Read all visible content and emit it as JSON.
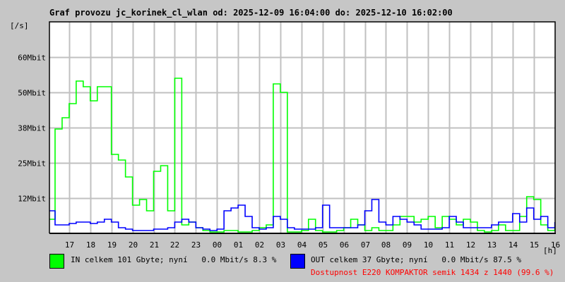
{
  "chart_data": {
    "type": "line",
    "title": "Graf provozu jc_korinek_cl_wlan od: 2025-12-09 16:04:00 do: 2025-12-10 16:02:00",
    "ylabel": "[/s]",
    "xlabel": "[h]",
    "ylim": [
      0,
      75
    ],
    "y_unit": "Mbit",
    "grid": true,
    "y_ticks": [
      {
        "value": 12.5,
        "label": "12Mbit"
      },
      {
        "value": 25,
        "label": "25Mbit"
      },
      {
        "value": 37.5,
        "label": "38Mbit"
      },
      {
        "value": 50,
        "label": "50Mbit"
      },
      {
        "value": 62.5,
        "label": "60Mbit"
      }
    ],
    "x_start": "16:04",
    "x_end": "16:02",
    "x_ticks": [
      "17",
      "18",
      "19",
      "20",
      "21",
      "22",
      "23",
      "00",
      "01",
      "02",
      "03",
      "04",
      "05",
      "06",
      "07",
      "08",
      "09",
      "10",
      "11",
      "12",
      "13",
      "14",
      "15",
      "16"
    ],
    "x": [
      "16:04",
      "16:20",
      "16:40",
      "17:00",
      "17:20",
      "17:40",
      "18:00",
      "18:20",
      "18:40",
      "19:00",
      "19:20",
      "19:40",
      "20:00",
      "20:20",
      "20:40",
      "21:00",
      "21:20",
      "21:40",
      "22:00",
      "22:20",
      "22:40",
      "23:00",
      "23:20",
      "23:40",
      "00:00",
      "00:20",
      "00:40",
      "01:00",
      "01:20",
      "01:40",
      "02:00",
      "02:20",
      "02:40",
      "03:00",
      "03:20",
      "03:40",
      "04:00",
      "04:20",
      "04:40",
      "05:00",
      "05:20",
      "05:40",
      "06:00",
      "06:20",
      "06:40",
      "07:00",
      "07:20",
      "07:40",
      "08:00",
      "08:20",
      "08:40",
      "09:00",
      "09:20",
      "09:40",
      "10:00",
      "10:20",
      "10:40",
      "11:00",
      "11:20",
      "11:40",
      "12:00",
      "12:20",
      "12:40",
      "13:00",
      "13:20",
      "13:40",
      "14:00",
      "14:20",
      "14:40",
      "15:00",
      "15:20",
      "15:40",
      "16:00"
    ],
    "series": [
      {
        "name": "IN",
        "color": "#00ff00",
        "values": [
          5,
          37,
          41,
          46,
          54,
          52,
          47,
          52,
          52,
          28,
          26,
          20,
          10,
          12,
          8,
          22,
          24,
          8,
          55,
          3,
          4,
          2,
          1,
          0.5,
          0.5,
          1,
          1,
          0.5,
          0.5,
          1,
          2,
          3,
          53,
          50,
          0.5,
          0.5,
          1,
          5,
          1,
          0.5,
          0.5,
          1,
          2,
          5,
          3,
          1,
          2,
          1,
          1,
          3,
          6,
          6,
          4,
          5,
          6,
          2,
          6,
          5,
          3,
          5,
          4,
          1,
          0.5,
          1,
          3,
          1,
          1,
          6,
          13,
          12,
          3,
          1,
          2
        ]
      },
      {
        "name": "OUT",
        "color": "#0000ff",
        "values": [
          8,
          3,
          3,
          3.5,
          4,
          4,
          3.5,
          4,
          5,
          4,
          2,
          1.5,
          1,
          1,
          1,
          1.5,
          1.5,
          2,
          4,
          5,
          4,
          2,
          1.5,
          1,
          1.5,
          8,
          9,
          10,
          6,
          2,
          1.5,
          2,
          6,
          5,
          2,
          1.5,
          1.5,
          1.5,
          2,
          10,
          2,
          2,
          2,
          2,
          3,
          8,
          12,
          4,
          3,
          6,
          5,
          4,
          3,
          1.5,
          1.5,
          1.5,
          2,
          6,
          4,
          2,
          2,
          2,
          2,
          3,
          4,
          4,
          7,
          4,
          9,
          5,
          6,
          2,
          4
        ]
      }
    ]
  },
  "legend": {
    "in_text": "IN celkem 101 Gbyte; nyní   0.0 Mbit/s 8.3 %",
    "out_text": "OUT celkem 37 Gbyte; nyní   0.0 Mbit/s 87.5 %",
    "availability": "Dostupnost E220 KOMPAKTOR semik 1434 z 1440 (99.6 %)",
    "availability_color": "#ff0000"
  }
}
